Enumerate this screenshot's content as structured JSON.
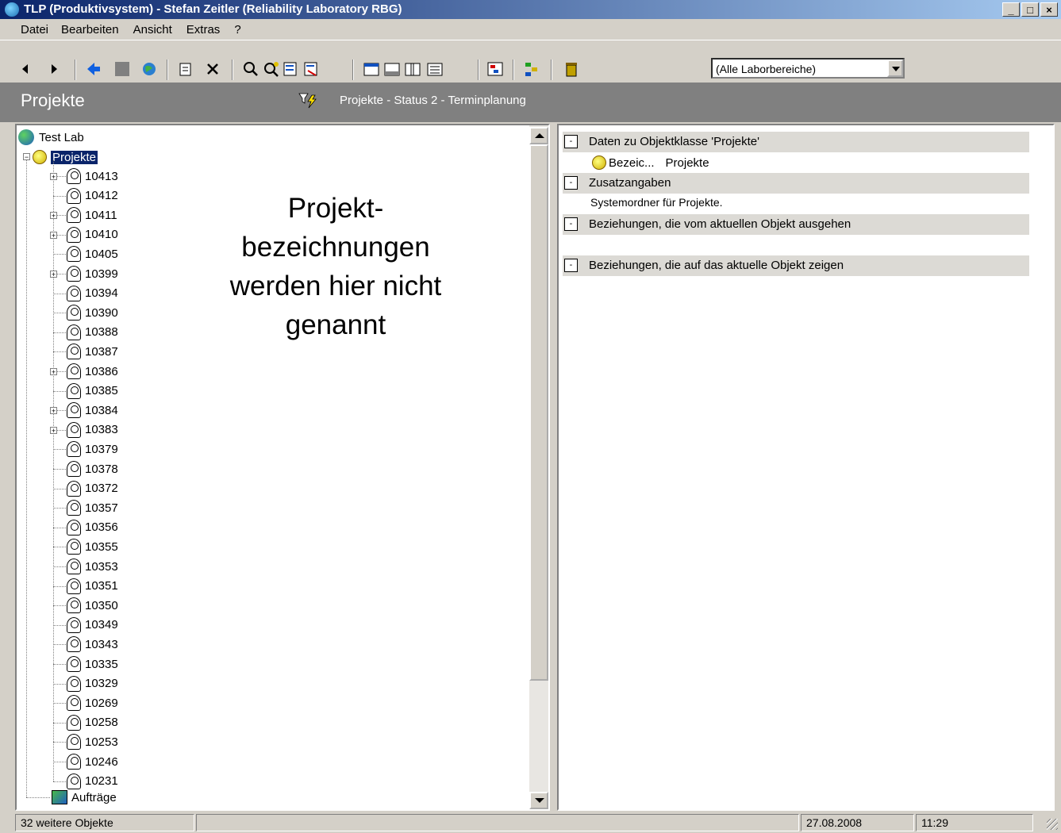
{
  "window": {
    "title": "TLP (Produktivsystem) - Stefan Zeitler (Reliability Laboratory RBG)",
    "minimize": "_",
    "maximize": "□",
    "close": "×"
  },
  "menu": [
    "Datei",
    "Bearbeiten",
    "Ansicht",
    "Extras",
    "?"
  ],
  "toolbar": {
    "combo_value": "(Alle Laborbereiche)"
  },
  "header": {
    "title": "Projekte",
    "filter_text": "Projekte - Status 2 - Terminplanung"
  },
  "tree": {
    "root": "Test Lab",
    "folder": "Projekte",
    "items": [
      {
        "label": "10413",
        "expandable": true
      },
      {
        "label": "10412",
        "expandable": false
      },
      {
        "label": "10411",
        "expandable": true
      },
      {
        "label": "10410",
        "expandable": true
      },
      {
        "label": "10405",
        "expandable": false
      },
      {
        "label": "10399",
        "expandable": true
      },
      {
        "label": "10394",
        "expandable": false
      },
      {
        "label": "10390",
        "expandable": false
      },
      {
        "label": "10388",
        "expandable": false
      },
      {
        "label": "10387",
        "expandable": false
      },
      {
        "label": "10386",
        "expandable": true
      },
      {
        "label": "10385",
        "expandable": false
      },
      {
        "label": "10384",
        "expandable": true
      },
      {
        "label": "10383",
        "expandable": true
      },
      {
        "label": "10379",
        "expandable": false
      },
      {
        "label": "10378",
        "expandable": false
      },
      {
        "label": "10372",
        "expandable": false
      },
      {
        "label": "10357",
        "expandable": false
      },
      {
        "label": "10356",
        "expandable": false
      },
      {
        "label": "10355",
        "expandable": false
      },
      {
        "label": "10353",
        "expandable": false
      },
      {
        "label": "10351",
        "expandable": false
      },
      {
        "label": "10350",
        "expandable": false
      },
      {
        "label": "10349",
        "expandable": false
      },
      {
        "label": "10343",
        "expandable": false
      },
      {
        "label": "10335",
        "expandable": false
      },
      {
        "label": "10329",
        "expandable": false
      },
      {
        "label": "10269",
        "expandable": false
      },
      {
        "label": "10258",
        "expandable": false
      },
      {
        "label": "10253",
        "expandable": false
      },
      {
        "label": "10246",
        "expandable": false
      },
      {
        "label": "10231",
        "expandable": false
      }
    ],
    "orders": "Aufträge",
    "overlay_lines": [
      "Projekt-",
      "bezeichnungen",
      "werden hier nicht",
      "genannt"
    ]
  },
  "details": {
    "section1_title": "Daten zu Objektklasse 'Projekte'",
    "prop_label": "Bezeic...",
    "prop_value": "Projekte",
    "section2_title": "Zusatzangaben",
    "description": "Systemordner für Projekte.",
    "section3_title": "Beziehungen, die vom aktuellen Objekt ausgehen",
    "section4_title": "Beziehungen, die auf das aktuelle Objekt zeigen",
    "collapse_symbol": "-"
  },
  "status": {
    "left": "32 weitere Objekte",
    "date": "27.08.2008",
    "time": "11:29"
  }
}
